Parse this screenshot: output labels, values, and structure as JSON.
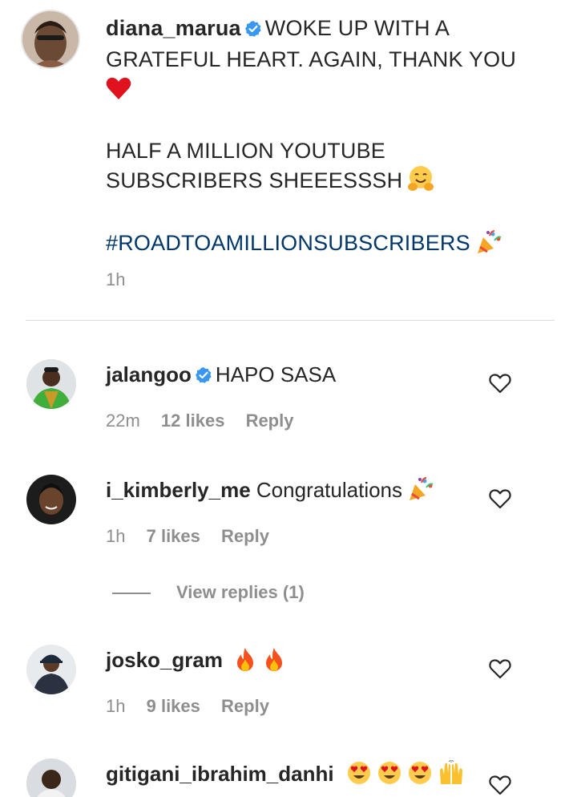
{
  "caption": {
    "username": "diana_marua",
    "verified": true,
    "line1": "WOKE UP WITH A GRATEFUL HEART. AGAIN, THANK YOU",
    "line1_emoji": "heart-emoji",
    "line2": "HALF A MILLION YOUTUBE SUBSCRIBERS SHEEESSSH",
    "line2_emoji": "hugging-face-emoji",
    "hashtag": "#ROADTOAMILLIONSUBSCRIBERS",
    "hashtag_emoji": "party-popper-emoji",
    "time": "1h"
  },
  "comments": [
    {
      "username": "jalangoo",
      "verified": true,
      "text": "HAPO SASA",
      "time": "22m",
      "likes": "12 likes",
      "reply": "Reply"
    },
    {
      "username": "i_kimberly_me",
      "verified": false,
      "text": "Congratulations",
      "text_emoji": "party-popper-emoji",
      "time": "1h",
      "likes": "7 likes",
      "reply": "Reply"
    },
    {
      "username": "josko_gram",
      "verified": false,
      "text": "",
      "text_emoji": "fire-emoji fire-emoji",
      "time": "1h",
      "likes": "9 likes",
      "reply": "Reply"
    },
    {
      "username": "gitigani_ibrahim_danhi",
      "verified": false,
      "text": "",
      "text_emoji": "heart-eyes-emoji x3, raising-hands-emoji"
    }
  ],
  "view_replies": "View replies (1)",
  "colors": {
    "text": "#262626",
    "muted": "#8e8e8e",
    "hashtag": "#00376b",
    "verified": "#3897f0",
    "divider": "#dbdbdb"
  }
}
